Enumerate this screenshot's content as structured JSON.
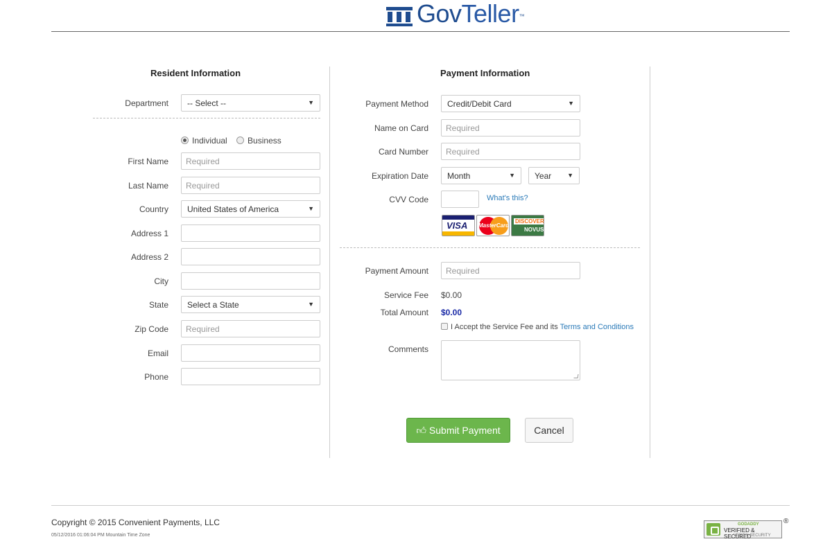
{
  "brand": {
    "name_bold": "Gov",
    "name_thin": "Teller",
    "tm": "™"
  },
  "resident": {
    "heading": "Resident Information",
    "department_label": "Department",
    "department_value": "-- Select --",
    "type_options": [
      "Individual",
      "Business"
    ],
    "type_selected": "Individual",
    "first_name_label": "First Name",
    "first_name_placeholder": "Required",
    "last_name_label": "Last Name",
    "last_name_placeholder": "Required",
    "country_label": "Country",
    "country_value": "United States of America",
    "address1_label": "Address 1",
    "address2_label": "Address 2",
    "city_label": "City",
    "state_label": "State",
    "state_value": "Select a State",
    "zip_label": "Zip Code",
    "zip_placeholder": "Required",
    "email_label": "Email",
    "phone_label": "Phone"
  },
  "payment": {
    "heading": "Payment Information",
    "method_label": "Payment Method",
    "method_value": "Credit/Debit Card",
    "name_on_card_label": "Name on Card",
    "name_on_card_placeholder": "Required",
    "card_number_label": "Card Number",
    "card_number_placeholder": "Required",
    "expiration_label": "Expiration Date",
    "month_value": "Month",
    "year_value": "Year",
    "cvv_label": "CVV Code",
    "whats_this": "What's this?",
    "card_logos": {
      "visa": "VISA",
      "mastercard": "MasterCard",
      "discover": "DISCOVER",
      "novus": "NOVUS"
    },
    "amount_label": "Payment Amount",
    "amount_placeholder": "Required",
    "service_fee_label": "Service Fee",
    "service_fee_value": "$0.00",
    "total_label": "Total Amount",
    "total_value": "$0.00",
    "accept_text": "I Accept the Service Fee and its",
    "terms_link": "Terms and Conditions",
    "comments_label": "Comments"
  },
  "actions": {
    "submit": "Submit Payment",
    "cancel": "Cancel"
  },
  "footer": {
    "copyright": "Copyright © 2015 Convenient Payments, LLC",
    "timestamp": "05/12/2016 01:06:04 PM Mountain Time Zone",
    "badge": {
      "top": "GODADDY",
      "main": "VERIFIED & SECURED",
      "sub": "VERIFY SECURITY",
      "reg": "®"
    }
  },
  "colors": {
    "brand": "#1f4c8f",
    "submit": "#6cb64c",
    "link": "#2a7ab8",
    "total": "#1a2aa6"
  }
}
